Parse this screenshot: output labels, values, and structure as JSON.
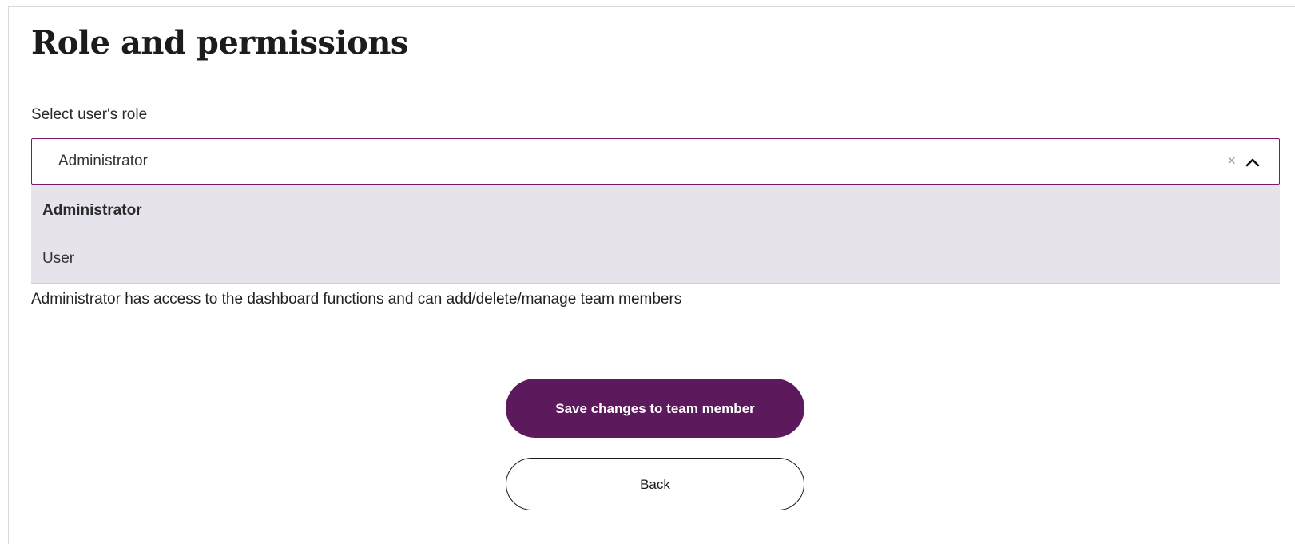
{
  "header": {
    "title": "Role and permissions"
  },
  "role_field": {
    "label": "Select user's role",
    "value": "Administrator",
    "clear_glyph": "×",
    "options": [
      {
        "label": "Administrator",
        "selected": true
      },
      {
        "label": "User",
        "selected": false
      }
    ],
    "help_text": "Administrator has access to the dashboard functions and can add/delete/manage team members"
  },
  "actions": {
    "save_label": "Save changes to team member",
    "back_label": "Back"
  },
  "colors": {
    "accent": "#5c1a5c",
    "select_border": "#7a1a6b",
    "dropdown_bg": "#e6e4ea"
  },
  "icons": {
    "clear": "close-icon",
    "toggle": "chevron-up-icon"
  }
}
